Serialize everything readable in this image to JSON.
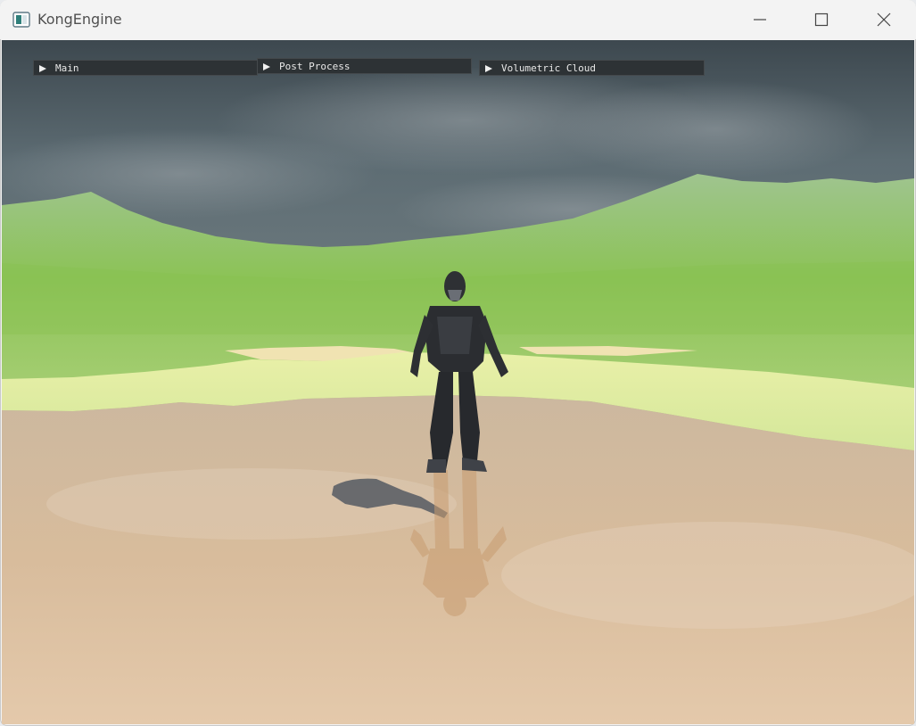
{
  "window": {
    "title": "KongEngine",
    "icon": "app-window-icon",
    "controls": [
      "minimize-icon",
      "maximize-icon",
      "close-icon"
    ]
  },
  "panels": [
    {
      "label": "Main",
      "icon": "collapse-arrow-icon"
    },
    {
      "label": "Post Process",
      "icon": "collapse-arrow-icon"
    },
    {
      "label": "Volumetric Cloud",
      "icon": "collapse-arrow-icon"
    }
  ],
  "colors": {
    "sky": "#5a6a72",
    "terrain": "#8fc356",
    "ground": "#d8bc9c",
    "panel": "#2d3235"
  }
}
